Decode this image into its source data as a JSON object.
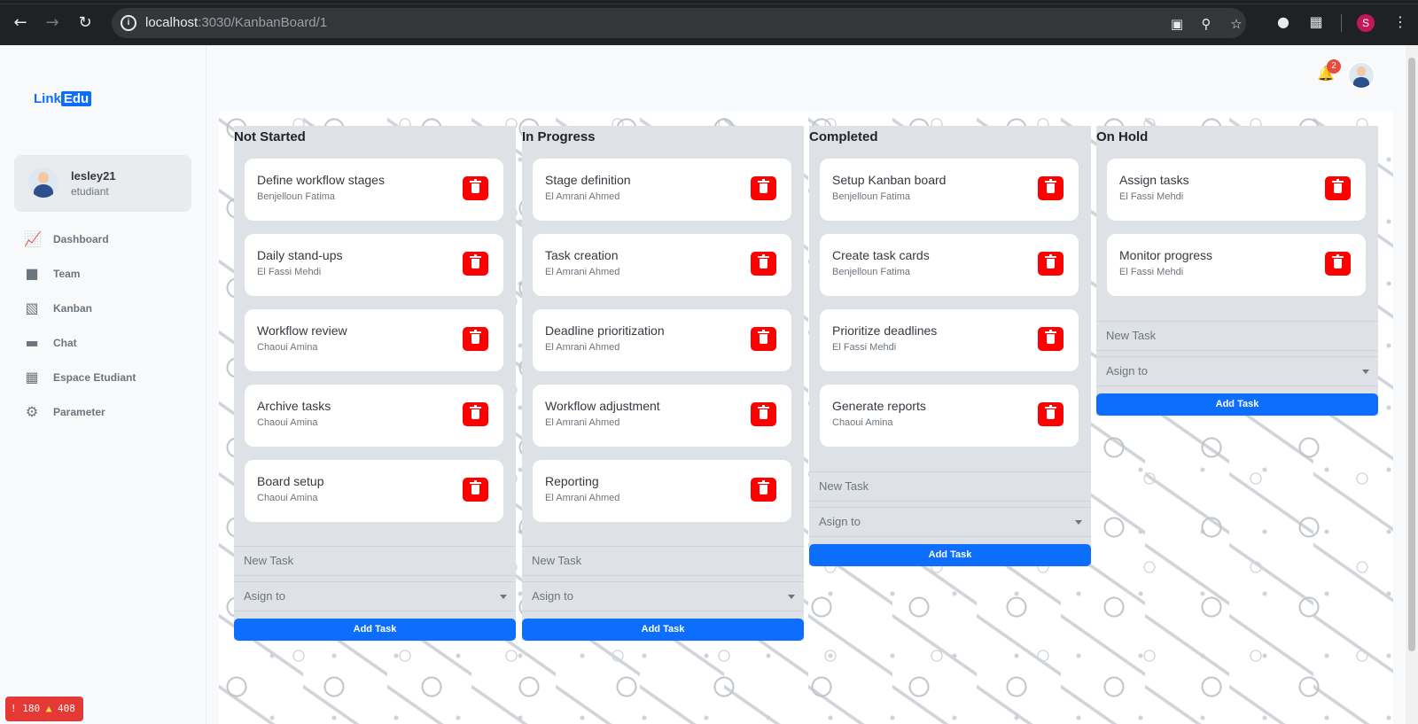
{
  "browser": {
    "url_host": "localhost",
    "url_rest": ":3030/KanbanBoard/1",
    "profile_initial": "S"
  },
  "sidebar": {
    "logo_text": "Link",
    "logo_box": "Edu",
    "user": {
      "name": "lesley21",
      "role": "etudiant"
    },
    "items": [
      {
        "label": "Dashboard",
        "icon": "chart-icon"
      },
      {
        "label": "Team",
        "icon": "person-icon"
      },
      {
        "label": "Kanban",
        "icon": "kanban-icon"
      },
      {
        "label": "Chat",
        "icon": "chat-icon"
      },
      {
        "label": "Espace Etudiant",
        "icon": "table-icon"
      },
      {
        "label": "Parameter",
        "icon": "gear-icon"
      }
    ]
  },
  "header": {
    "notification_count": "2"
  },
  "columns": [
    {
      "title": "Not Started",
      "tasks": [
        {
          "title": "Define workflow stages",
          "assignee": "Benjelloun Fatima"
        },
        {
          "title": "Daily stand-ups",
          "assignee": "El Fassi Mehdi"
        },
        {
          "title": "Workflow review",
          "assignee": "Chaoui Amina"
        },
        {
          "title": "Archive tasks",
          "assignee": "Chaoui Amina"
        },
        {
          "title": "Board setup",
          "assignee": "Chaoui Amina"
        }
      ],
      "new_task_placeholder": "New Task",
      "assign_placeholder": "Asign to",
      "add_label": "Add Task"
    },
    {
      "title": "In Progress",
      "tasks": [
        {
          "title": "Stage definition",
          "assignee": "El Amrani Ahmed"
        },
        {
          "title": "Task creation",
          "assignee": "El Amrani Ahmed"
        },
        {
          "title": "Deadline prioritization",
          "assignee": "El Amrani Ahmed"
        },
        {
          "title": "Workflow adjustment",
          "assignee": "El Amrani Ahmed"
        },
        {
          "title": "Reporting",
          "assignee": "El Amrani Ahmed"
        }
      ],
      "new_task_placeholder": "New Task",
      "assign_placeholder": "Asign to",
      "add_label": "Add Task"
    },
    {
      "title": "Completed",
      "tasks": [
        {
          "title": "Setup Kanban board",
          "assignee": "Benjelloun Fatima"
        },
        {
          "title": "Create task cards",
          "assignee": "Benjelloun Fatima"
        },
        {
          "title": "Prioritize deadlines",
          "assignee": "El Fassi Mehdi"
        },
        {
          "title": "Generate reports",
          "assignee": "Chaoui Amina"
        }
      ],
      "new_task_placeholder": "New Task",
      "assign_placeholder": "Asign to",
      "add_label": "Add Task"
    },
    {
      "title": "On Hold",
      "tasks": [
        {
          "title": "Assign tasks",
          "assignee": "El Fassi Mehdi"
        },
        {
          "title": "Monitor progress",
          "assignee": "El Fassi Mehdi"
        }
      ],
      "new_task_placeholder": "New Task",
      "assign_placeholder": "Asign to",
      "add_label": "Add Task"
    }
  ],
  "dev_overlay": {
    "errors": "180",
    "warnings": "408"
  },
  "colors": {
    "primary": "#0d6efd",
    "danger": "#ff0000",
    "column_bg": "#dee2e6"
  }
}
